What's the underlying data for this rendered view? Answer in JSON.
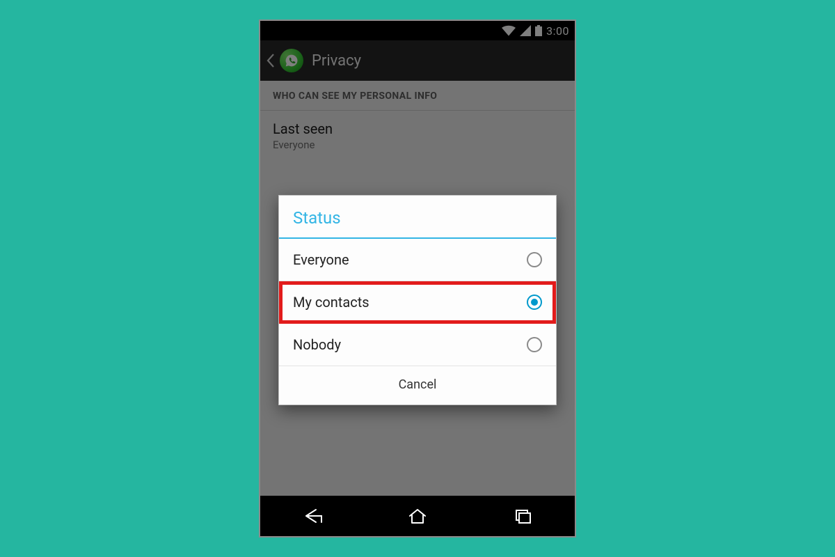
{
  "status_bar": {
    "clock": "3:00"
  },
  "action_bar": {
    "title": "Privacy"
  },
  "privacy_screen": {
    "section_header": "WHO CAN SEE MY PERSONAL INFO",
    "last_seen": {
      "label": "Last seen",
      "value": "Everyone"
    }
  },
  "dialog": {
    "title": "Status",
    "options": [
      {
        "label": "Everyone",
        "selected": false,
        "highlight": false
      },
      {
        "label": "My contacts",
        "selected": true,
        "highlight": true
      },
      {
        "label": "Nobody",
        "selected": false,
        "highlight": false
      }
    ],
    "cancel_label": "Cancel"
  }
}
